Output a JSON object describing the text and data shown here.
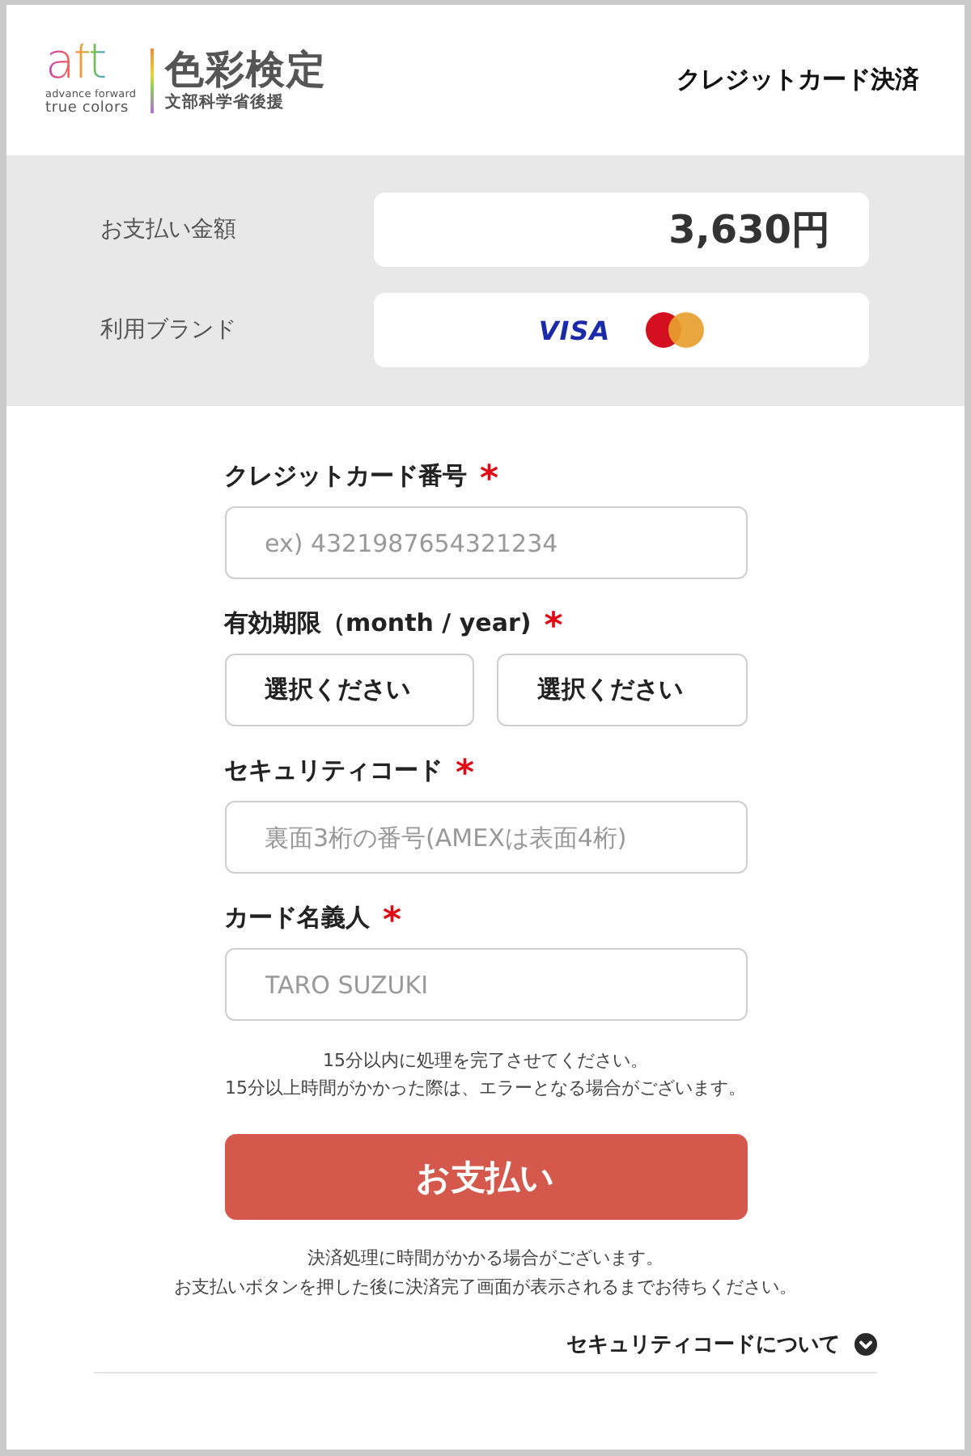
{
  "header": {
    "logo": {
      "mark": "aft",
      "tagline_top": "advance forward",
      "tagline_bottom": "true colors",
      "title": "色彩検定",
      "subtitle": "文部科学省後援"
    },
    "page_title": "クレジットカード決済"
  },
  "summary": {
    "rows": [
      {
        "kind": "amount",
        "label": "お支払い金額",
        "value": "3,630円"
      },
      {
        "kind": "brands",
        "label": "利用ブランド",
        "brands": [
          {
            "kind": "visa",
            "label": "VISA"
          },
          {
            "kind": "mastercard"
          }
        ]
      }
    ]
  },
  "required_mark": "*",
  "form": {
    "fields": [
      {
        "kind": "input",
        "label": "クレジットカード番号",
        "required": true,
        "placeholder": "ex) 4321987654321234"
      },
      {
        "kind": "selects",
        "label": "有効期限（month / year)",
        "required": true,
        "selects": [
          {
            "value": "選択ください"
          },
          {
            "value": "選択ください"
          }
        ]
      },
      {
        "kind": "input",
        "label": "セキュリティコード",
        "required": true,
        "placeholder": "裏面3桁の番号(AMEXは表面4桁)"
      },
      {
        "kind": "input",
        "label": "カード名義人",
        "required": true,
        "placeholder": "TARO SUZUKI"
      }
    ]
  },
  "time_notice": [
    "15分以内に処理を完了させてください。",
    "15分以上時間がかかった際は、エラーとなる場合がございます。"
  ],
  "pay_button": {
    "label": "お支払い"
  },
  "payment_notice": [
    "決済処理に時間がかかる場合がございます。",
    "お支払いボタンを押した後に決済完了画面が表示されるまでお待ちください。"
  ],
  "accordion": {
    "label": "セキュリティコードについて",
    "expanded": false
  }
}
